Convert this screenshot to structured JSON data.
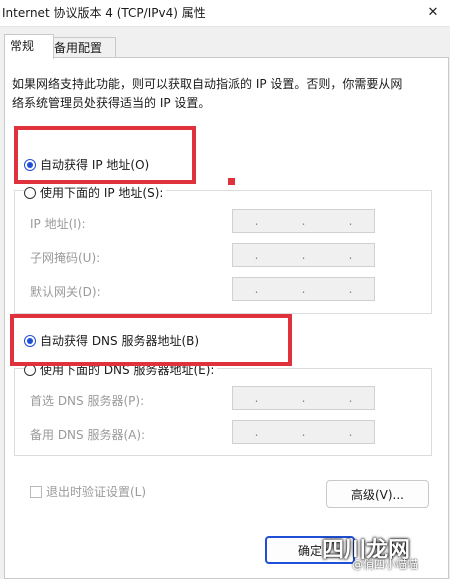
{
  "window": {
    "title": "Internet 协议版本 4 (TCP/IPv4) 属性",
    "close_glyph": "✕"
  },
  "tabs": [
    {
      "label": "常规"
    },
    {
      "label": "备用配置"
    }
  ],
  "description": "如果网络支持此功能，则可以获取自动指派的 IP 设置。否则，你需要从网络系统管理员处获得适当的 IP 设置。",
  "ip": {
    "auto_label": "自动获得 IP 地址(O)",
    "manual_label": "使用下面的 IP 地址(S):",
    "selected": "auto",
    "fields": [
      {
        "label": "IP 地址(I):"
      },
      {
        "label": "子网掩码(U):"
      },
      {
        "label": "默认网关(D):"
      }
    ]
  },
  "dns": {
    "auto_label": "自动获得 DNS 服务器地址(B)",
    "manual_label": "使用下面的 DNS 服务器地址(E):",
    "selected": "auto",
    "fields": [
      {
        "label": "首选 DNS 服务器(P):"
      },
      {
        "label": "备用 DNS 服务器(A):"
      }
    ]
  },
  "ip_separator": ".",
  "validate_on_exit": {
    "label": "退出时验证设置(L)",
    "checked": false
  },
  "buttons": {
    "advanced": "高级(V)...",
    "ok": "确定"
  },
  "watermark": {
    "brand": "四川龙网",
    "sub": "@俏四小喵喵"
  },
  "colors": {
    "highlight": "#e0323c",
    "radio_accent": "#1f4fd6"
  }
}
